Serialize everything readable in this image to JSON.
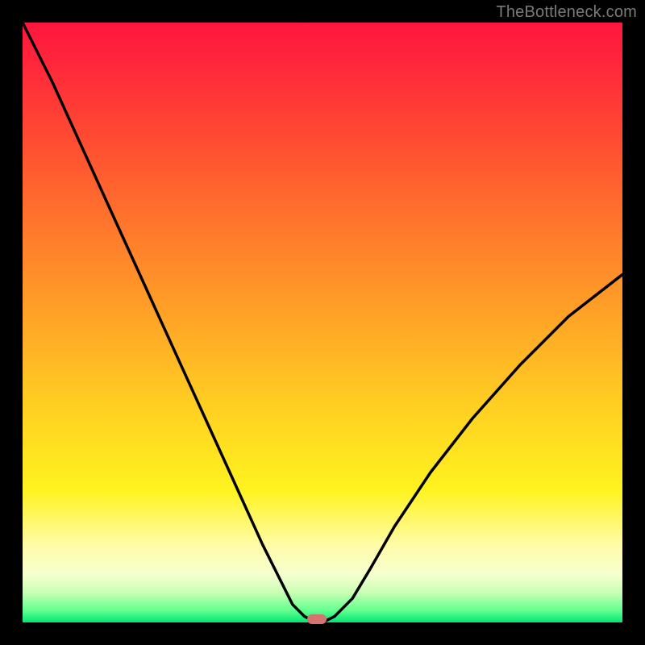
{
  "watermark": "TheBottleneck.com",
  "colors": {
    "curve": "#000000",
    "marker": "#d4746f"
  },
  "chart_data": {
    "type": "line",
    "title": "",
    "xlabel": "",
    "ylabel": "",
    "xlim": [
      0,
      1
    ],
    "ylim": [
      0,
      1
    ],
    "x": [
      0.0,
      0.05,
      0.1,
      0.15,
      0.2,
      0.25,
      0.3,
      0.35,
      0.4,
      0.43,
      0.45,
      0.47,
      0.49,
      0.5,
      0.52,
      0.55,
      0.58,
      0.62,
      0.68,
      0.75,
      0.83,
      0.91,
      1.0
    ],
    "values": [
      1.0,
      0.9,
      0.79,
      0.68,
      0.57,
      0.46,
      0.35,
      0.24,
      0.13,
      0.07,
      0.03,
      0.01,
      0.0,
      0.0,
      0.01,
      0.04,
      0.09,
      0.16,
      0.25,
      0.34,
      0.43,
      0.51,
      0.58
    ],
    "marker": {
      "x": 0.49,
      "y": 0.0
    },
    "note": "Approximate V-shaped bottleneck curve; x,y are normalized 0–1 within the gradient plot area. y=0 is bottom (green), y=1 is top (red)."
  }
}
